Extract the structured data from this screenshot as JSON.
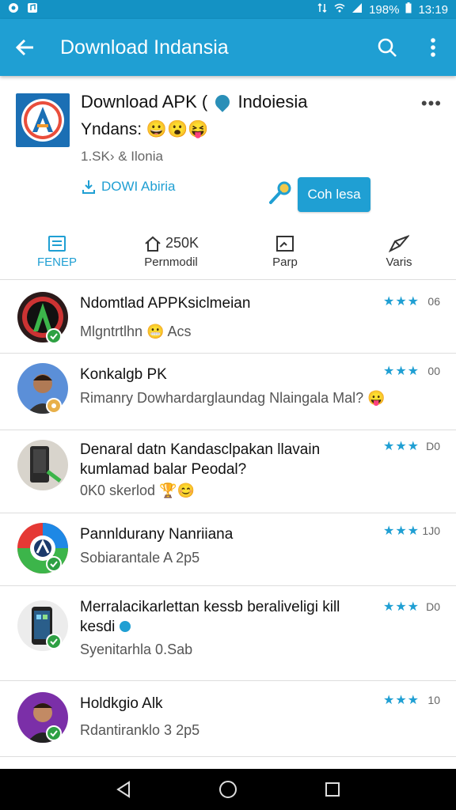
{
  "status": {
    "percent": "198%",
    "time": "13:19"
  },
  "appbar": {
    "title": "Download Indansia"
  },
  "app": {
    "title": "Download APK (",
    "title_end": "Indoiesia",
    "subtitle": "Yndans:",
    "subtitle_emoji": "😀😮😝",
    "meta": "1.SK› & Ilonia",
    "download_link": "DOWI Abiria",
    "cta": "Coh lesa"
  },
  "tabs": [
    {
      "label": "FENEP",
      "value": "",
      "icon": "doc-icon"
    },
    {
      "label": "Pernmodil",
      "value": "250K",
      "icon": "home-icon"
    },
    {
      "label": "Parp",
      "value": "",
      "icon": "image-icon"
    },
    {
      "label": "Varis",
      "value": "",
      "icon": "send-icon"
    }
  ],
  "reviews": [
    {
      "title": "Ndomtlad APPKsiclmeian",
      "sub": "Mlgntrtlhn 😬 Acs",
      "stars": "★★★",
      "num": "06"
    },
    {
      "title": "Konkalgb PK",
      "sub": "Rimanry Dowhardarglaundag Nlaingala Mal? 😛",
      "stars": "★★★",
      "num": "00"
    },
    {
      "title": "Denaral datn Kandasclpakan llavain",
      "title2": "kumlamad balar Peodal?",
      "sub": "0K0 skerlod 🏆😊",
      "stars": "★★★",
      "num": "D0"
    },
    {
      "title": "Pannldurany Nanriiana",
      "sub": "Sobiarantale A 2p5",
      "stars": "★★★",
      "num": "1J0"
    },
    {
      "title": "Merralacikarlettan kessb beraliveligi kill",
      "title2": "kesdi",
      "sub": "Syenitarhla 0.Sab",
      "stars": "★★★",
      "num": "D0"
    },
    {
      "title": "Holdkgio Alk",
      "sub": "Rdantiranklo 3 2p5",
      "stars": "★★★",
      "num": "10"
    }
  ],
  "colors": {
    "accent": "#1f9fd3",
    "statusbar": "#1492c4",
    "check": "#2ea043"
  }
}
